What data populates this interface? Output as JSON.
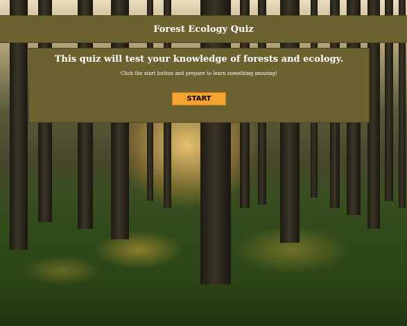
{
  "header": {
    "title": "Forest Ecology Quiz"
  },
  "intro": {
    "heading": "This quiz will test your knowledge of forests and ecology.",
    "subtext": "Click the start button and prepare to learn something amazing!",
    "start_label": "START"
  },
  "colors": {
    "panel_background": "#6b6230",
    "button_background": "#f5a332",
    "text": "#ffffff"
  }
}
